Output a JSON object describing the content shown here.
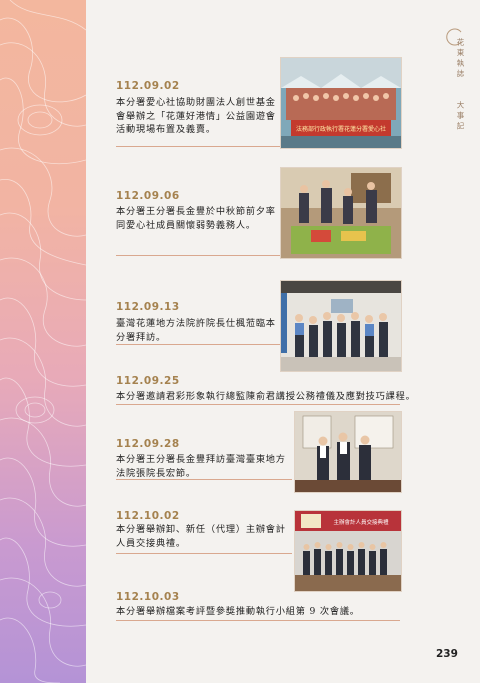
{
  "side": {
    "title": "花東執誌",
    "subtitle": "大事記"
  },
  "entries": [
    {
      "date": "112.09.02",
      "text": "本分署愛心社協助財團法人創世基金會舉辦之「花蓮好港情」公益園遊會活動現場布置及義賣。"
    },
    {
      "date": "112.09.06",
      "text": "本分署王分署長金豐於中秋節前夕率同愛心社成員關懷弱勢義務人。"
    },
    {
      "date": "112.09.13",
      "text": "臺灣花蓮地方法院許院長仕楓蒞臨本分署拜訪。"
    },
    {
      "date": "112.09.25",
      "text": "本分署邀請君彩形象執行總監陳俞君講授公務禮儀及應對技巧課程。"
    },
    {
      "date": "112.09.28",
      "text": "本分署王分署長金豐拜訪臺灣臺東地方法院張院長宏節。"
    },
    {
      "date": "112.10.02",
      "text": "本分署舉辦卸、新任（代理）主辦會計人員交接典禮。"
    },
    {
      "date": "112.10.03",
      "text": "本分署舉辦檔案考評暨參獎推動執行小組第 9 次會議。"
    }
  ],
  "photo_banner_text": "法務部行政執行署花蓮分署愛心社",
  "photo_meeting_banner_text": "主辦會計人員交接典禮",
  "page_number": "239",
  "colors": {
    "accent_gold": "#a5824f",
    "rule": "#d9a88f",
    "band_top": "#f3b79e",
    "band_bottom": "#b493d6"
  }
}
